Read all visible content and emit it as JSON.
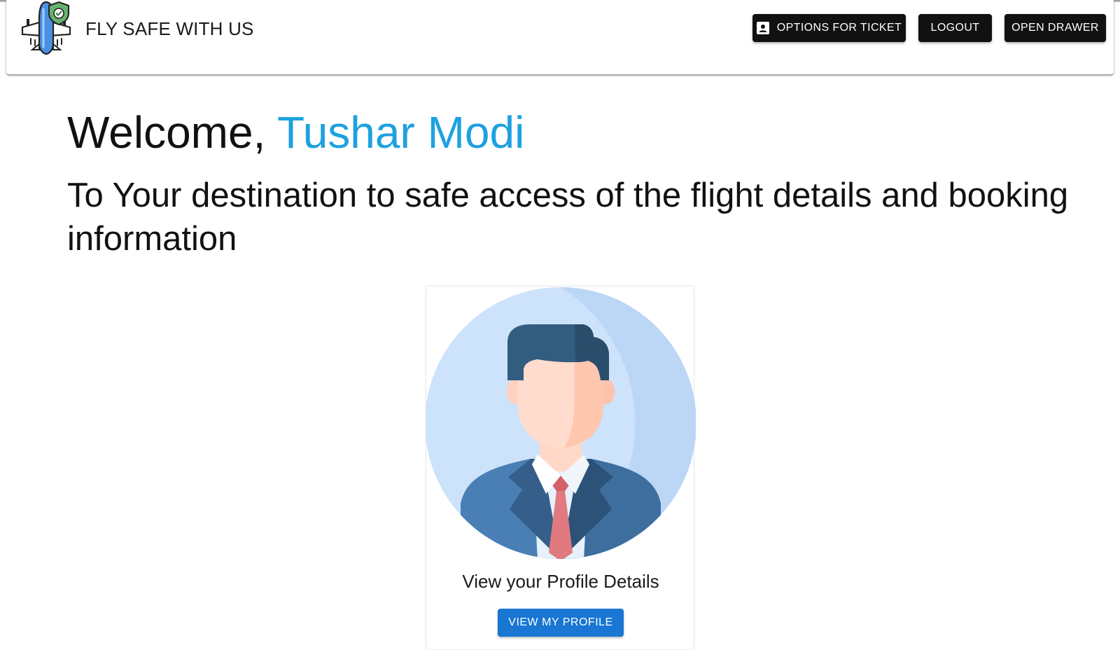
{
  "header": {
    "brand": "FLY SAFE WITH US",
    "logo_icon": "airplane-shield-icon",
    "buttons": {
      "ticket": "OPTIONS FOR TICKET",
      "ticket_icon": "contact-card-icon",
      "logout": "LOGOUT",
      "drawer": "OPEN DRAWER"
    }
  },
  "main": {
    "welcome_prefix": "Welcome, ",
    "user_name": "Tushar Modi",
    "subtitle": "To Your destination to safe access of the flight details and booking information",
    "card": {
      "avatar_icon": "businessman-avatar-icon",
      "text": "View your Profile Details",
      "button": "VIEW MY PROFILE"
    }
  },
  "colors": {
    "accent_name": "#1da1e0",
    "button_dark": "#111111",
    "button_primary": "#1976d2"
  }
}
